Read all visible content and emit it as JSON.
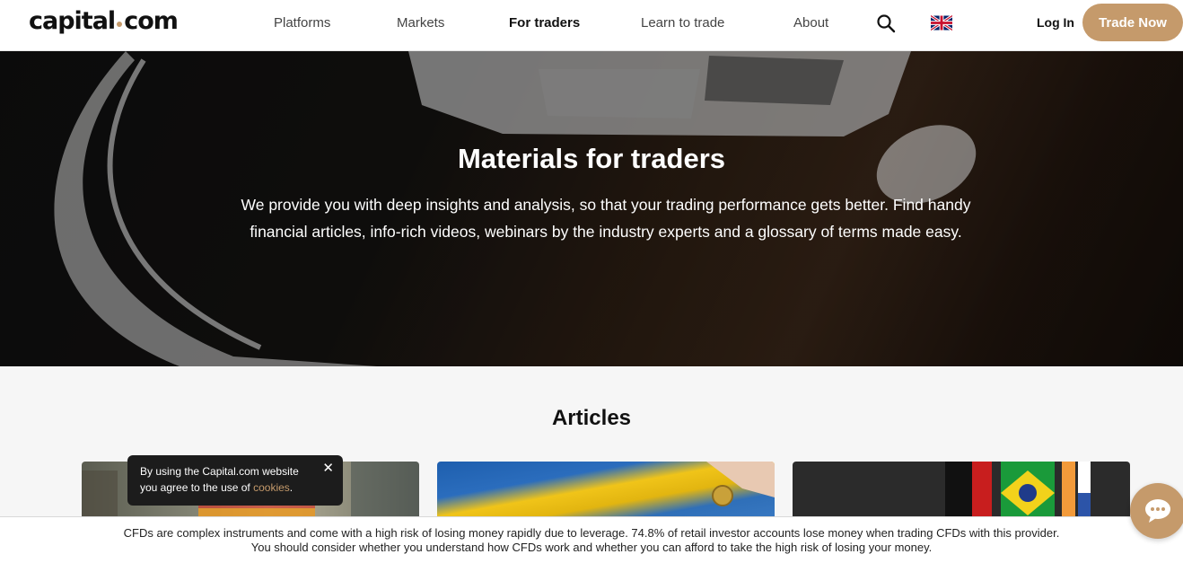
{
  "header": {
    "logo_left": "capital",
    "logo_right": "com",
    "nav": [
      "Platforms",
      "Markets",
      "For traders",
      "Learn to trade",
      "About"
    ],
    "active_nav": "For traders",
    "search_icon": "search-icon",
    "flag_icon": "uk-flag-icon",
    "login_label": "Log In",
    "trade_label": "Trade Now"
  },
  "hero": {
    "title": "Materials for traders",
    "text": "We provide you with deep insights and analysis, so that your trading performance gets better. Find handy financial articles, info-rich videos, webinars by the industry experts and a glossary of terms made easy."
  },
  "articles": {
    "title": "Articles"
  },
  "cookie": {
    "line1": "By using the Capital.com website",
    "line2_prefix": "you agree to the use of ",
    "link": "cookies",
    "suffix": ".",
    "close_glyph": "✕"
  },
  "risk": {
    "line1": "CFDs are complex instruments and come with a high risk of losing money rapidly due to leverage. 74.8% of retail investor accounts lose money when trading CFDs with this provider.",
    "line2": "You should consider whether you understand how CFDs work and whether you can afford to take the high risk of losing your money."
  },
  "colors": {
    "accent": "#c59a6b",
    "dark": "#1c1c1c"
  },
  "chat_icon": "chat-bubble-icon"
}
